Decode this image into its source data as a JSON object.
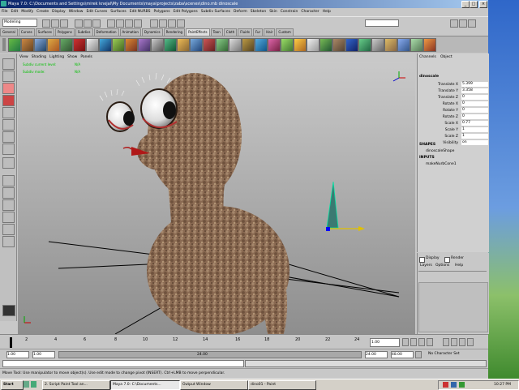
{
  "window": {
    "title": "Maya 7.0: C:\\Documents and Settings\\mirek knejal\\My Documents\\maya\\projects\\zaba\\scenes\\dino.mb    dinoscale",
    "min": "_",
    "max": "□",
    "close": "×"
  },
  "menu": [
    "File",
    "Edit",
    "Modify",
    "Create",
    "Display",
    "Window",
    "Edit Curves",
    "Surfaces",
    "Edit NURBS",
    "Polygons",
    "Edit Polygons",
    "Subdiv Surfaces",
    "Deform",
    "Skeleton",
    "Skin",
    "Constrain",
    "Character",
    "Help"
  ],
  "status_line": {
    "mode": "Modeling"
  },
  "shelf_tabs": [
    "General",
    "Curves",
    "Surfaces",
    "Polygons",
    "Subdivs",
    "Deformation",
    "Animation",
    "Dynamics",
    "Rendering",
    "PaintEffects",
    "Toon",
    "Cloth",
    "Fluids",
    "Fur",
    "Hair",
    "Custom"
  ],
  "active_shelf_tab": "PaintEffects",
  "panel_menu": [
    "View",
    "Shading",
    "Lighting",
    "Show",
    "Panels"
  ],
  "hud": {
    "line1_label": "Subdiv current level:",
    "line1_value": "N/A",
    "line2_label": "Subdiv mode:",
    "line2_value": "N/A"
  },
  "channel_box": {
    "header_tabs": [
      "Channels",
      "Object"
    ],
    "object_name": "dinoscale",
    "attributes": [
      {
        "name": "Translate X",
        "value": "5.399"
      },
      {
        "name": "Translate Y",
        "value": "3.358"
      },
      {
        "name": "Translate Z",
        "value": "0"
      },
      {
        "name": "Rotate X",
        "value": "0"
      },
      {
        "name": "Rotate Y",
        "value": "0"
      },
      {
        "name": "Rotate Z",
        "value": "0"
      },
      {
        "name": "Scale X",
        "value": "0.77"
      },
      {
        "name": "Scale Y",
        "value": "1"
      },
      {
        "name": "Scale Z",
        "value": "1"
      },
      {
        "name": "Visibility",
        "value": "on"
      }
    ],
    "shapes_label": "SHAPES",
    "shape_name": "dinoscaleShape",
    "inputs_label": "INPUTS",
    "input_name": "makeNurbCone1"
  },
  "layer_editor": {
    "display_label": "Display",
    "render_label": "Render",
    "menu": [
      "Layers",
      "Options",
      "Help"
    ]
  },
  "time_slider": {
    "ticks": [
      "2",
      "4",
      "6",
      "8",
      "10",
      "12",
      "14",
      "16",
      "18",
      "20",
      "22",
      "24"
    ],
    "current_frame": "1.00"
  },
  "range_slider": {
    "start": "1.00",
    "inner_start": "1.00",
    "bar_label": "24.00",
    "inner_end": "24.00",
    "end": "48.00",
    "char_set": "No Character Set"
  },
  "help_line": "Move Tool: Use manipulator to move object(s). Use edit mode to change pivot (INSERT). Ctrl+LMB to move perpendicular.",
  "taskbar": {
    "start": "Start",
    "items": [
      "2. Script Paint Tool an...",
      "Maya 7.0: C:\\Documents...",
      "Output Window",
      "dino01 - Paint"
    ],
    "clock": "10:27 PM"
  },
  "colors": {
    "desktop": "#3a6ea5",
    "viewport_top": "#c9c9c9",
    "viewport_bottom": "#8e8e8e",
    "creature_skin": "#8a6a52",
    "cone": "#3a7a72"
  }
}
